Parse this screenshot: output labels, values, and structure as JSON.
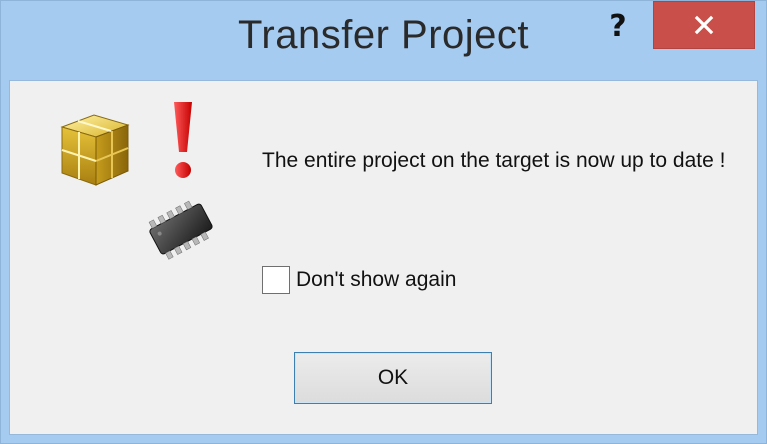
{
  "window": {
    "title": "Transfer Project",
    "help_label": "?",
    "close_icon": "close-icon"
  },
  "content": {
    "message": "The entire project on the target is now up to date !",
    "checkbox_label": "Don't show again",
    "checkbox_checked": false,
    "ok_label": "OK",
    "icons": [
      "project-box-icon",
      "exclamation-icon",
      "chip-icon"
    ]
  },
  "colors": {
    "titlebar": "#a6cbf0",
    "close_button": "#c9504a",
    "client_background": "#f0f0f0",
    "ok_border": "#3c7fb1"
  }
}
